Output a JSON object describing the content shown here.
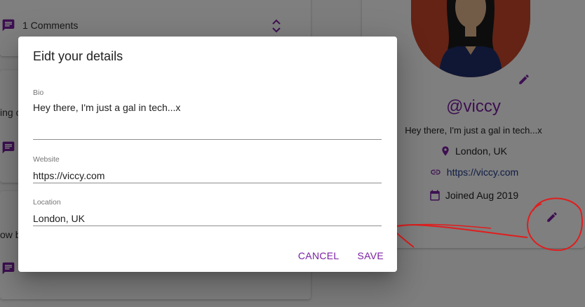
{
  "feed": {
    "top_comments_label": "1 Comments",
    "fragment_middle": "ing c",
    "fragment_bottom": "ow b"
  },
  "profile": {
    "handle": "@viccy",
    "bio": "Hey there, I'm just a gal in tech...x",
    "location": "London, UK",
    "website": "https://viccy.com",
    "joined": "Joined Aug 2019"
  },
  "dialog": {
    "title": "Eidt your details",
    "bio": {
      "label": "Bio",
      "value": "Hey there, I'm just a gal in tech...x"
    },
    "website": {
      "label": "Website",
      "value": "https://viccy.com"
    },
    "location": {
      "label": "Location",
      "value": "London, UK"
    },
    "cancel_label": "CANCEL",
    "save_label": "SAVE"
  },
  "icons": {
    "comment": "chat-bubble-icon",
    "edit": "pencil-icon",
    "location": "map-pin-icon",
    "link": "link-icon",
    "calendar": "calendar-icon",
    "expand": "unfold-chevrons-icon"
  },
  "colors": {
    "accent": "#7b1fa2",
    "link": "#1e3a8a",
    "annotation": "#e11d1d",
    "avatar_bg": "#c8472b"
  }
}
